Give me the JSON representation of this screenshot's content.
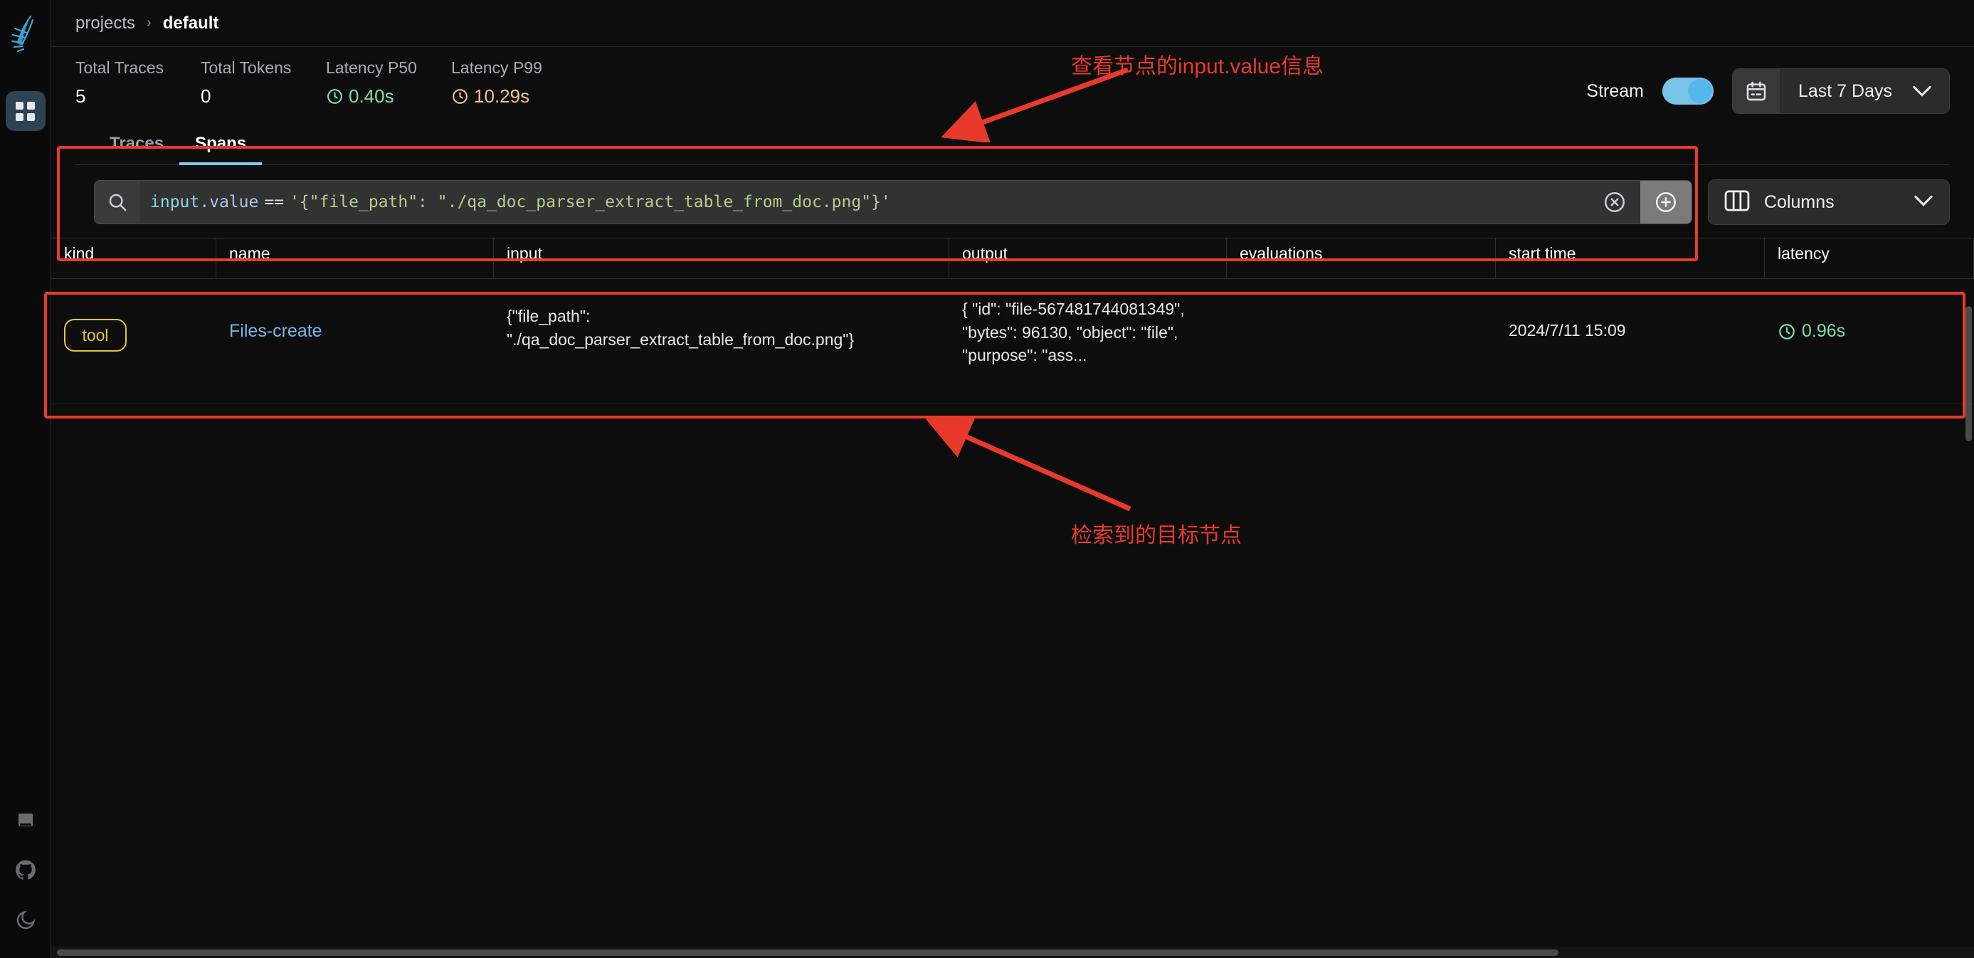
{
  "rail": {
    "logo_icon": "phoenix-logo-icon",
    "nav_tile_icon": "grid-dashboard-icon",
    "bottom_icons": [
      {
        "name": "book-icon",
        "label": "Docs"
      },
      {
        "name": "github-icon",
        "label": "GitHub"
      },
      {
        "name": "moon-icon",
        "label": "Dark mode"
      }
    ]
  },
  "breadcrumb": {
    "root": "projects",
    "separator": "›",
    "current": "default"
  },
  "metrics": [
    {
      "label": "Total Traces",
      "value": "5",
      "icon": "",
      "color": "#ffffff"
    },
    {
      "label": "Total Tokens",
      "value": "0",
      "icon": "",
      "color": "#ffffff"
    },
    {
      "label": "Latency P50",
      "value": "0.40s",
      "icon": "clock-icon",
      "color": "#7fe0a8"
    },
    {
      "label": "Latency P99",
      "value": "10.29s",
      "icon": "clock-icon",
      "color": "#f2c58a"
    }
  ],
  "header_controls": {
    "stream_label": "Stream",
    "stream_on": true,
    "date_range": "Last 7 Days",
    "calendar_icon": "calendar-icon",
    "chevron_icon": "chevron-down-icon"
  },
  "tabs": [
    {
      "label": "Traces",
      "active": false
    },
    {
      "label": "Spans",
      "active": true
    }
  ],
  "search": {
    "icon": "search-icon",
    "query_full": "input.value == '{\"file_path\": \"./qa_doc_parser_extract_table_from_doc.png\"}'",
    "token_prop": "input",
    "token_field": ".value",
    "token_op": "==",
    "token_string": "'{\"file_path\": \"./qa_doc_parser_extract_table_from_doc.png\"}'",
    "placeholder": "Filter spans",
    "clear_icon": "clear-circle-icon",
    "add_icon": "add-circle-icon"
  },
  "columns_button": {
    "label": "Columns",
    "icon": "columns-icon",
    "chevron_icon": "chevron-down-icon"
  },
  "table": {
    "headers": [
      "kind",
      "name",
      "input",
      "output",
      "evaluations",
      "start time",
      "latency"
    ],
    "rows": [
      {
        "kind": "tool",
        "name": "Files-create",
        "input": "{\"file_path\": \"./qa_doc_parser_extract_table_from_doc.png\"}",
        "output": "{ \"id\": \"file-567481744081349\", \"bytes\": 96130, \"object\": \"file\", \"purpose\": \"ass...",
        "evaluations": "",
        "start_time": "2024/7/11 15:09",
        "latency": "0.96s",
        "latency_icon": "clock-icon"
      }
    ]
  },
  "annotations": [
    {
      "text": "查看节点的input.value信息",
      "color": "#e8392b"
    },
    {
      "text": "检索到的目标节点",
      "color": "#e8392b"
    }
  ],
  "colors": {
    "accent_blue": "#7ec8ef",
    "annotation_red": "#e8392b",
    "tool_badge": "#e3c72e",
    "latency_green": "#7fe0a8",
    "latency_amber": "#f2c58a"
  }
}
